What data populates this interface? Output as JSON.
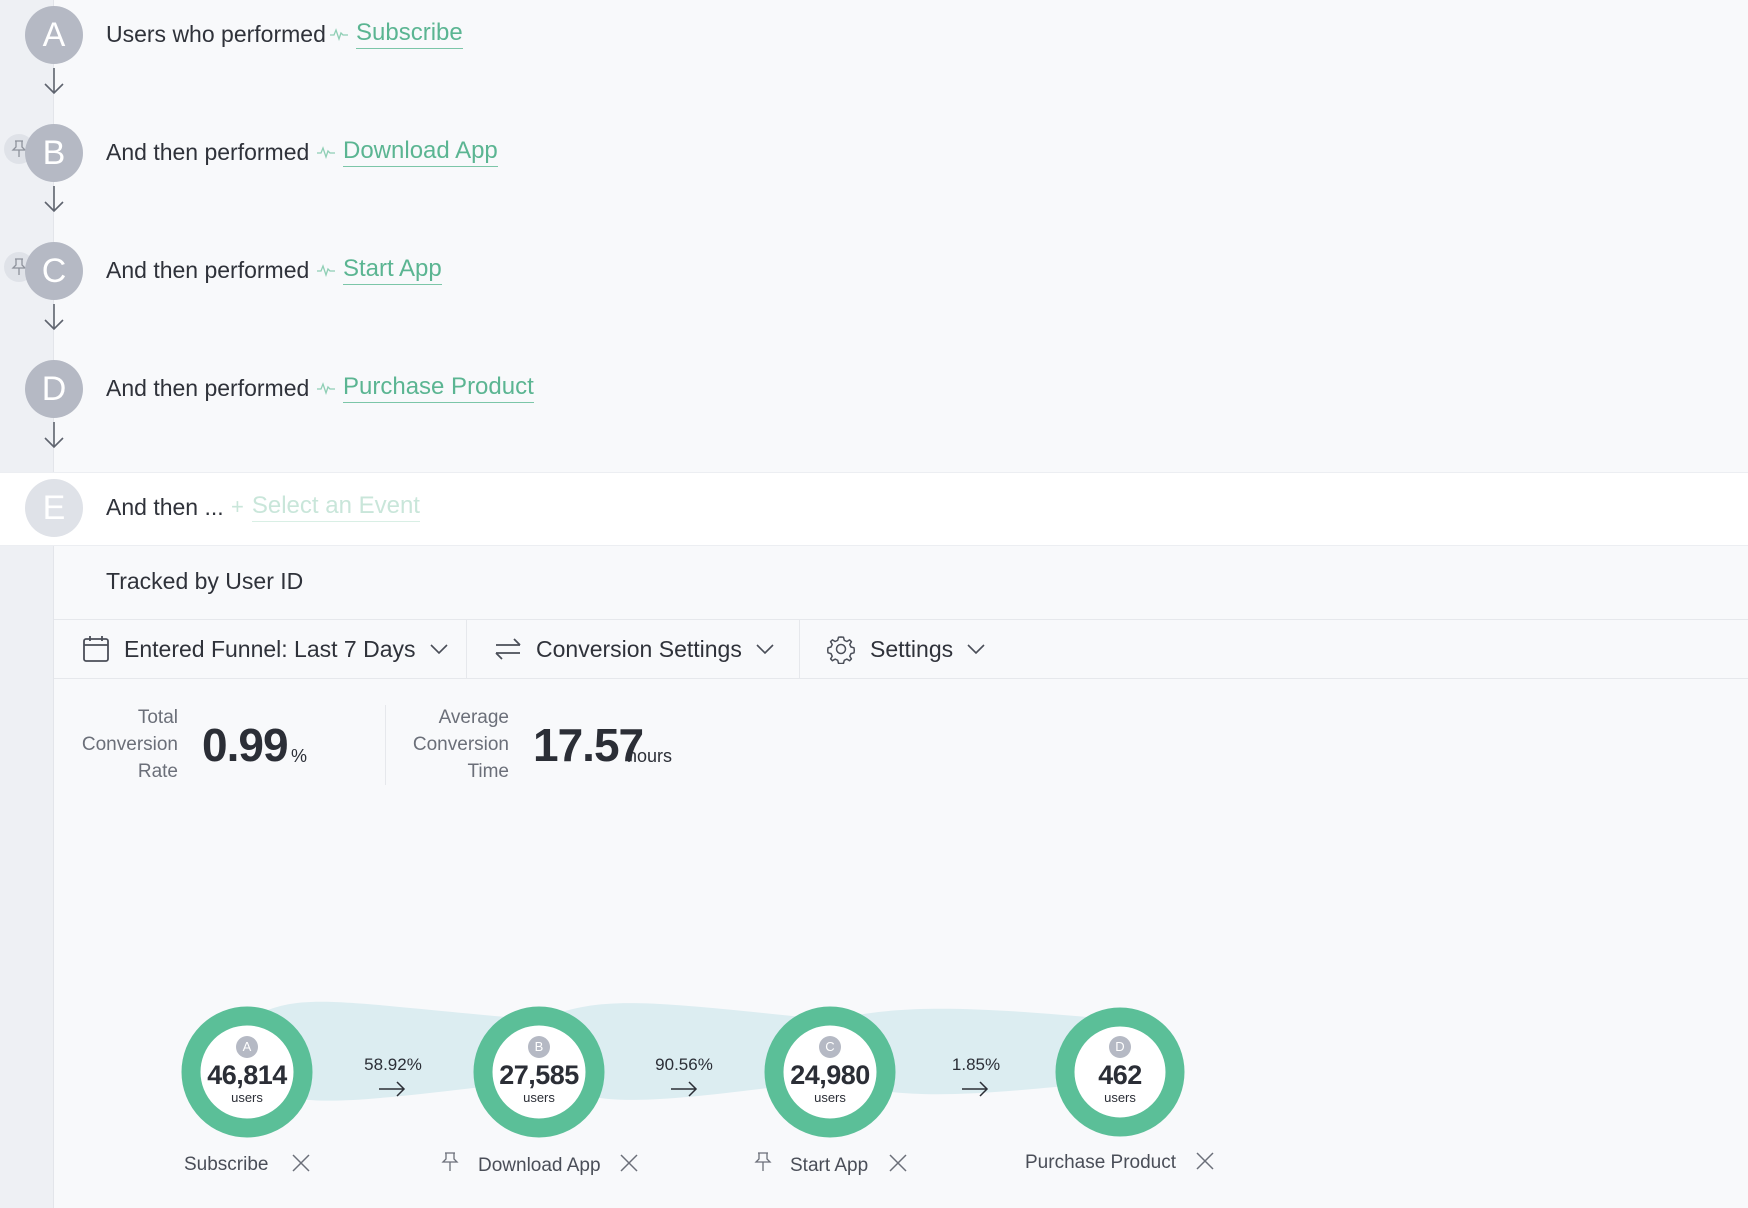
{
  "steps": [
    {
      "letter": "A",
      "prefix": "Users who performed",
      "event": "Subscribe",
      "pinned": false
    },
    {
      "letter": "B",
      "prefix": "And then performed",
      "event": "Download App",
      "pinned": true
    },
    {
      "letter": "C",
      "prefix": "And then performed",
      "event": "Start App",
      "pinned": true
    },
    {
      "letter": "D",
      "prefix": "And then performed",
      "event": "Purchase Product",
      "pinned": false
    }
  ],
  "next_step": {
    "letter": "E",
    "prefix": "And then ...",
    "placeholder": "Select an Event"
  },
  "tracked_by": "Tracked by User ID",
  "toolbar": {
    "date_range": "Entered Funnel: Last 7 Days",
    "conversion_settings": "Conversion Settings",
    "settings": "Settings"
  },
  "metrics": {
    "total_conversion_rate": {
      "label_lines": [
        "Total",
        "Conversion",
        "Rate"
      ],
      "value": "0.99",
      "unit": "%"
    },
    "average_conversion_time": {
      "label_lines": [
        "Average",
        "Conversion",
        "Time"
      ],
      "value": "17.57",
      "unit": "hours"
    }
  },
  "funnel": {
    "nodes": [
      {
        "letter": "A",
        "count": "46,814",
        "unit": "users",
        "label": "Subscribe",
        "pinned": false
      },
      {
        "letter": "B",
        "count": "27,585",
        "unit": "users",
        "label": "Download App",
        "pinned": true
      },
      {
        "letter": "C",
        "count": "24,980",
        "unit": "users",
        "label": "Start App",
        "pinned": true
      },
      {
        "letter": "D",
        "count": "462",
        "unit": "users",
        "label": "Purchase Product",
        "pinned": false
      }
    ],
    "rates": [
      "58.92%",
      "90.56%",
      "1.85%"
    ]
  },
  "colors": {
    "accent": "#5bb592",
    "ring": "#5bbf98",
    "flow": "#dcedf1",
    "step_circle": "#b5b9c4"
  }
}
